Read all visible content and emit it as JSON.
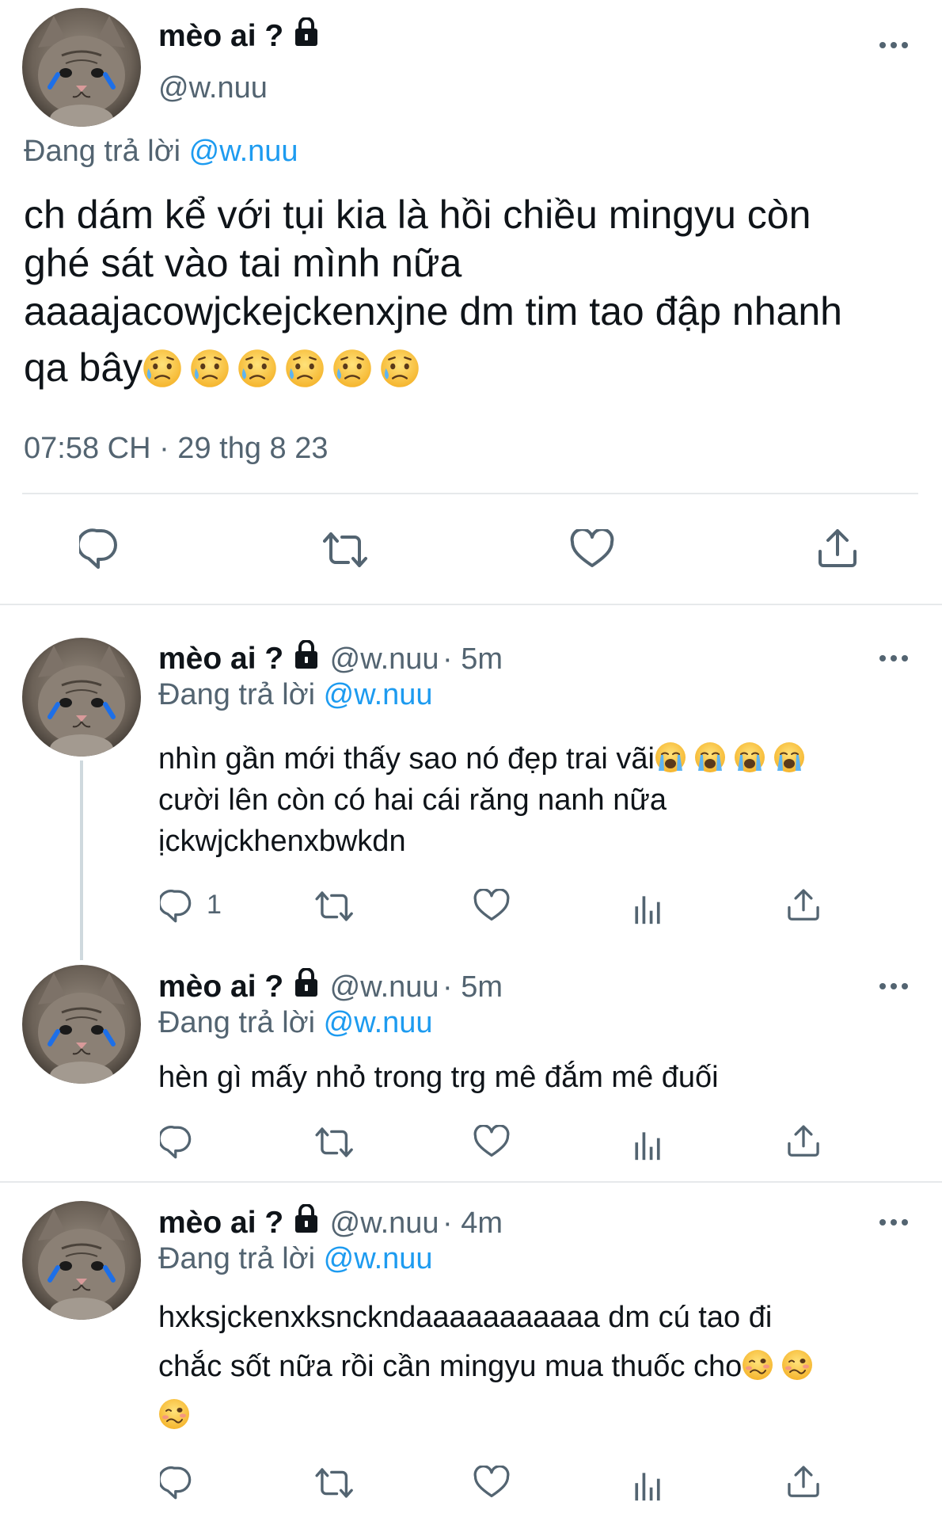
{
  "main_tweet": {
    "display_name": "mèo ai ?",
    "handle": "@w.nuu",
    "replying_prefix": "Đang trả lời",
    "replying_to": "@w.nuu",
    "text_lines": [
      "ch dám kể với tụi kia là hồi chiều mingyu còn",
      "ghé sát vào tai mình nữa",
      "aaaajacowjckejckenxjne dm tim tao đập nhanh",
      "qa bây"
    ],
    "emoji_name": "sad-but-relieved-face",
    "emoji_count": 6,
    "timestamp": "07:58 CH · 29 thg 8 23",
    "actions": [
      "reply-icon",
      "retweet-icon",
      "like-icon",
      "share-icon"
    ]
  },
  "replies": [
    {
      "display_name": "mèo ai ?",
      "handle": "@w.nuu",
      "time": "· 5m",
      "replying_prefix": "Đang trả lời",
      "replying_to": "@w.nuu",
      "text_lines": [
        "nhìn gần mới thấy sao nó đẹp trai vãi",
        "cười lên còn có hai cái răng nanh nữa",
        "ịckwjckhenxbwkdn"
      ],
      "emoji_name": "loudly-crying-face",
      "emoji_count": 4,
      "reply_count": "1"
    },
    {
      "display_name": "mèo ai ?",
      "handle": "@w.nuu",
      "time": "· 5m",
      "replying_prefix": "Đang trả lời",
      "replying_to": "@w.nuu",
      "text_lines": [
        "hèn gì mấy nhỏ trong trg mê đắm mê đuối"
      ],
      "reply_count": ""
    },
    {
      "display_name": "mèo ai ?",
      "handle": "@w.nuu",
      "time": "· 4m",
      "replying_prefix": "Đang trả lời",
      "replying_to": "@w.nuu",
      "text_lines": [
        "hxksjckenxksnckndaaaaaaaaaaa dm cú tao đi",
        "chắc sốt nữa rồi cần mingyu mua thuốc cho"
      ],
      "emoji_name": "woozy-face",
      "emoji_count": 3,
      "reply_count": ""
    }
  ],
  "colors": {
    "accent": "#1d9bf0",
    "muted": "#536471",
    "text": "#0f1419",
    "divider": "#e6e9eb"
  }
}
